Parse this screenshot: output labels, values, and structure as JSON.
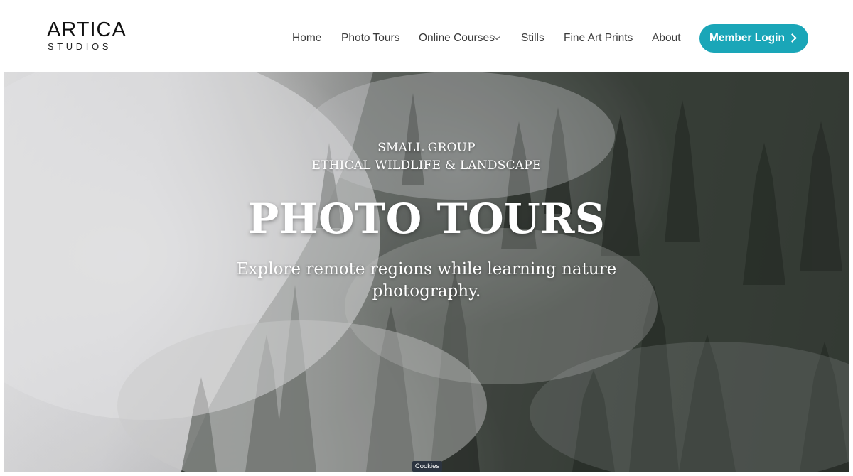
{
  "brand": {
    "name": "ARTICA",
    "subtitle": "STUDIOS"
  },
  "nav": {
    "items": [
      {
        "label": "Home"
      },
      {
        "label": "Photo Tours"
      },
      {
        "label": "Online Courses",
        "has_dropdown": true
      },
      {
        "label": "Stills"
      },
      {
        "label": "Fine Art Prints"
      },
      {
        "label": "About"
      }
    ],
    "login_label": "Member Login",
    "login_icon": "chevron-right-icon",
    "dropdown_icon": "chevron-down-icon"
  },
  "hero": {
    "eyebrow_line1": "SMALL GROUP",
    "eyebrow_line2": "ETHICAL WILDLIFE & LANDSCAPE",
    "title": "PHOTO TOURS",
    "description_line1": "Explore remote regions while learning nature",
    "description_line2": "photography."
  },
  "cookie_banner": {
    "label": "Cookies"
  },
  "colors": {
    "accent": "#1aa6b8",
    "nav_text": "#3a3a3a",
    "cookie_bg": "#2c3440"
  }
}
